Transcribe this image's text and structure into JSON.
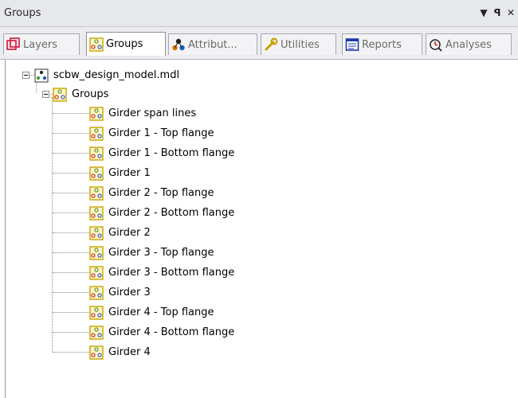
{
  "panel": {
    "title": "Groups",
    "menu_glyph": "▼",
    "pin_glyph": "ᵖ",
    "close_glyph": "✕"
  },
  "tabs": [
    {
      "label": "Layers",
      "icon": "layers-icon",
      "active": false
    },
    {
      "label": "Groups",
      "icon": "groups-icon",
      "active": true
    },
    {
      "label": "Attribut...",
      "icon": "attributes-icon",
      "active": false
    },
    {
      "label": "Utilities",
      "icon": "wrench-icon",
      "active": false
    },
    {
      "label": "Reports",
      "icon": "reports-icon",
      "active": false
    },
    {
      "label": "Analyses",
      "icon": "analyses-icon",
      "active": false
    }
  ],
  "tree": {
    "root": {
      "label": "scbw_design_model.mdl",
      "expanded": true
    },
    "groups_node": {
      "label": "Groups",
      "expanded": true
    },
    "items": [
      {
        "label": "Girder span lines"
      },
      {
        "label": "Girder 1 - Top flange"
      },
      {
        "label": "Girder 1 - Bottom flange"
      },
      {
        "label": "Girder 1"
      },
      {
        "label": "Girder 2 - Top flange"
      },
      {
        "label": "Girder 2 - Bottom flange"
      },
      {
        "label": "Girder 2"
      },
      {
        "label": "Girder 3 - Top flange"
      },
      {
        "label": "Girder 3 - Bottom flange"
      },
      {
        "label": "Girder 3"
      },
      {
        "label": "Girder 4 - Top flange"
      },
      {
        "label": "Girder 4 - Bottom flange"
      },
      {
        "label": "Girder 4"
      }
    ]
  },
  "colors": {
    "titlebar_bg": "#e7e8ec",
    "tabbar_bg": "#ececf0",
    "group_icon_border": "#c8a200",
    "group_icon_fill": "#fff8c8"
  }
}
